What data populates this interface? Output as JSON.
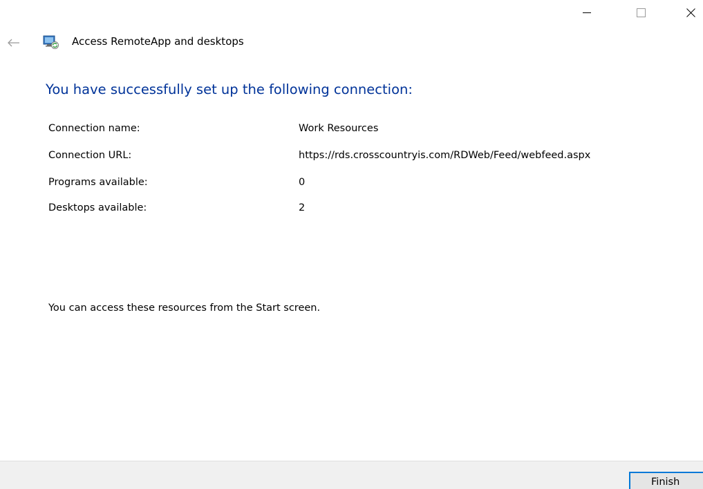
{
  "window": {
    "title": "Access RemoteApp and desktops",
    "caption_buttons": {
      "minimize_icon": "minimize-icon",
      "maximize_icon": "maximize-icon",
      "close_icon": "close-icon"
    },
    "back_icon": "back-arrow-icon",
    "app_icon": "remoteapp-icon"
  },
  "main": {
    "heading": "You have successfully set up the following connection:",
    "details": [
      {
        "label": "Connection name:",
        "value": "Work Resources"
      },
      {
        "label": "Connection URL:",
        "value": "https://rds.crosscountryis.com/RDWeb/Feed/webfeed.aspx"
      },
      {
        "label": "Programs available:",
        "value": "0"
      },
      {
        "label": "Desktops available:",
        "value": "2"
      }
    ],
    "info": "You can access these resources from the Start screen."
  },
  "footer": {
    "finish_label": "Finish"
  },
  "colors": {
    "heading": "#003399",
    "accent": "#0078d7",
    "footer_bg": "#f0f0f0"
  }
}
